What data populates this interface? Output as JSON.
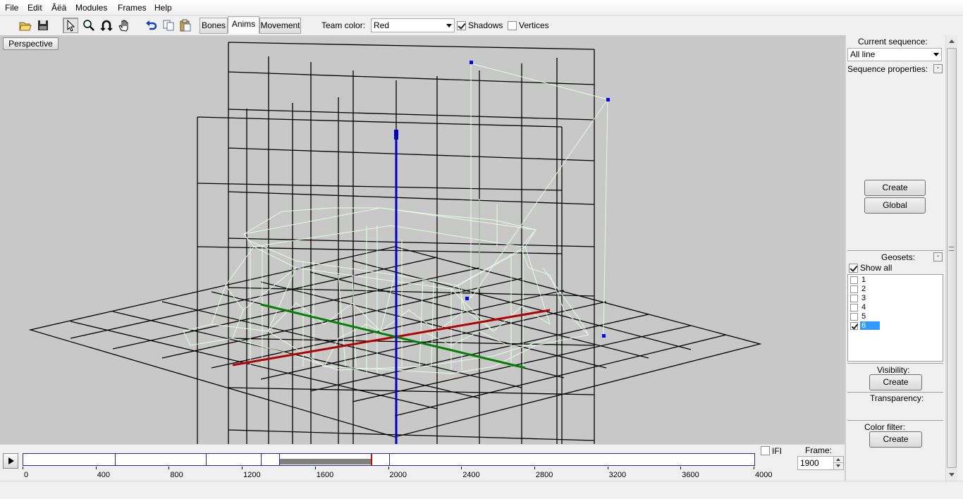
{
  "menu": {
    "items": [
      "File",
      "Edit",
      "Âëä",
      "Modules",
      "Frames",
      "Help"
    ]
  },
  "toolbar": {
    "icons": [
      "open-icon",
      "save-icon",
      "select-arrow-icon",
      "zoom-icon",
      "rotate-icon",
      "pan-hand-icon",
      "undo-icon",
      "copy-icon",
      "paste-icon"
    ],
    "tabs": [
      {
        "label": "Bones",
        "active": false
      },
      {
        "label": "Anims",
        "active": true
      },
      {
        "label": "Movement",
        "active": false
      }
    ],
    "team_color_label": "Team color:",
    "team_color_value": "Red",
    "shadows_label": "Shadows",
    "shadows_checked": true,
    "vertices_label": "Vertices",
    "vertices_checked": false
  },
  "viewport": {
    "view_mode_label": "Perspective",
    "background_color": "#c8c8c8",
    "axis_colors": {
      "x": "#b00000",
      "y": "#008000",
      "z": "#0000c0"
    },
    "mesh_color": "#e6ffe6"
  },
  "timeline": {
    "ticks": [
      "0",
      "400",
      "800",
      "1200",
      "1600",
      "2000",
      "2400",
      "2800",
      "3200",
      "3600",
      "4000"
    ],
    "range_max": 4000,
    "keyframe_markers": [
      500,
      1000,
      1300,
      1400,
      2000
    ],
    "selected_range": [
      1400,
      1900
    ],
    "current_frame_marker": 1900,
    "ifi_label": "IFI",
    "ifi_checked": false,
    "frame_label": "Frame:",
    "frame_value": "1900"
  },
  "panel": {
    "current_sequence_label": "Current sequence:",
    "current_sequence_value": "All line",
    "sequence_properties_label": "Sequence properties:",
    "create_label": "Create",
    "global_label": "Global",
    "geosets_label": "Geosets:",
    "show_all_label": "Show all",
    "show_all_checked": true,
    "geosets": [
      {
        "label": "1",
        "checked": false,
        "selected": false
      },
      {
        "label": "2",
        "checked": false,
        "selected": false
      },
      {
        "label": "3",
        "checked": false,
        "selected": false
      },
      {
        "label": "4",
        "checked": false,
        "selected": false
      },
      {
        "label": "5",
        "checked": false,
        "selected": false
      },
      {
        "label": "6",
        "checked": true,
        "selected": true
      }
    ],
    "visibility_label": "Visibility:",
    "visibility_create_label": "Create",
    "transparency_label": "Transparency:",
    "color_filter_label": "Color filter:",
    "color_filter_create_label": "Create",
    "collapse_glyph": "-"
  }
}
